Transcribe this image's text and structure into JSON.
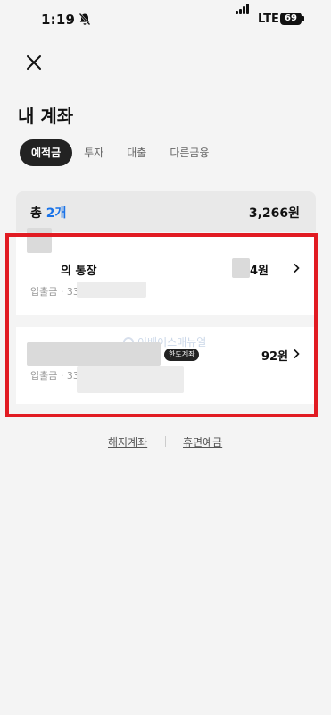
{
  "status_bar": {
    "time": "1:19",
    "network": "LTE",
    "battery": "69"
  },
  "header": {
    "title": "내 계좌"
  },
  "tabs": [
    {
      "label": "예적금",
      "active": true
    },
    {
      "label": "투자",
      "active": false
    },
    {
      "label": "대출",
      "active": false
    },
    {
      "label": "다른금융",
      "active": false
    }
  ],
  "summary": {
    "label_prefix": "총",
    "count": "2개",
    "amount": "3,266원"
  },
  "accounts": [
    {
      "name_suffix": "의 통장",
      "sub_prefix": "입출금 · 33",
      "balance_suffix": "4원"
    },
    {
      "badge": "한도계좌",
      "sub_prefix": "입출금 · 33",
      "balance": "92원"
    }
  ],
  "watermark": "이베이스매뉴얼",
  "footer": {
    "closed_accounts": "해지계좌",
    "dormant_deposits": "휴면예금"
  },
  "colors": {
    "highlight": "#e11b22",
    "accent": "#1a73e8"
  }
}
